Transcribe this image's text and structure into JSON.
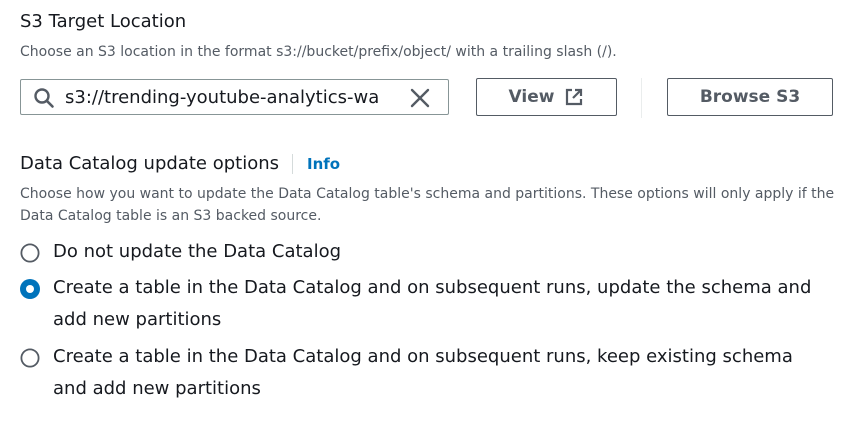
{
  "s3_target": {
    "title": "S3 Target Location",
    "description": "Choose an S3 location in the format s3://bucket/prefix/object/ with a trailing slash (/).",
    "input_value": "s3://trending-youtube-analytics-wa",
    "view_button": "View",
    "browse_button": "Browse S3"
  },
  "catalog_options": {
    "title": "Data Catalog update options",
    "info_link": "Info",
    "description": "Choose how you want to update the Data Catalog table's schema and partitions. These options will only apply if the Data Catalog table is an S3 backed source.",
    "options": [
      {
        "label": "Do not update the Data Catalog",
        "selected": false
      },
      {
        "label": "Create a table in the Data Catalog and on subsequent runs, update the schema and add new partitions",
        "selected": true
      },
      {
        "label": "Create a table in the Data Catalog and on subsequent runs, keep existing schema and add new partitions",
        "selected": false
      }
    ]
  },
  "icons": {
    "search": "search-icon",
    "clear": "close-icon",
    "external": "external-link-icon"
  },
  "colors": {
    "accent": "#0073bb",
    "text": "#16191f",
    "secondary_text": "#545b64",
    "border": "#879596"
  }
}
